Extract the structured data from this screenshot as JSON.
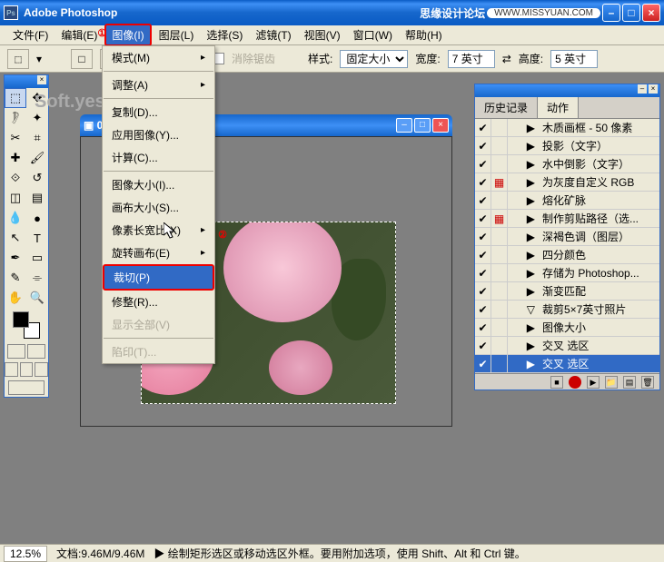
{
  "titlebar": {
    "app_name": "Adobe Photoshop",
    "forum": "思缘设计论坛",
    "url_pill": "WWW.MISSYUAN.COM"
  },
  "menubar": {
    "file": "文件(F)",
    "edit": "编辑(E)",
    "image": "图像(I)",
    "layer": "图层(L)",
    "select": "选择(S)",
    "filter": "滤镜(T)",
    "view": "视图(V)",
    "window": "窗口(W)",
    "help": "帮助(H)"
  },
  "annotations": {
    "one": "①",
    "two": "②"
  },
  "optbar": {
    "antialias": "消除锯齿",
    "style_label": "样式:",
    "style_value": "固定大小",
    "width_label": "宽度:",
    "width_value": "7 英寸",
    "height_label": "高度:",
    "height_value": "5 英寸"
  },
  "image_menu": {
    "mode": "模式(M)",
    "adjust": "调整(A)",
    "duplicate": "复制(D)...",
    "apply": "应用图像(Y)...",
    "calc": "计算(C)...",
    "img_size": "图像大小(I)...",
    "canvas_size": "画布大小(S)...",
    "pixel_ratio": "像素长宽比(X)",
    "rotate": "旋转画布(E)",
    "crop": "裁切(P)",
    "trim": "修整(R)...",
    "reveal": "显示全部(V)",
    "trap": "陷印(T)..."
  },
  "doc": {
    "title": "00... ...GB/8)"
  },
  "watermark": "Soft.yesky.c",
  "history": {
    "tab1": "历史记录",
    "tab2": "动作",
    "items": [
      {
        "check": true,
        "icon": "",
        "indent": 1,
        "arrow": "▶",
        "text": "木质画框 - 50 像素"
      },
      {
        "check": true,
        "icon": "",
        "indent": 1,
        "arrow": "▶",
        "text": "投影（文字）"
      },
      {
        "check": true,
        "icon": "",
        "indent": 1,
        "arrow": "▶",
        "text": "水中倒影（文字）"
      },
      {
        "check": true,
        "icon": "rec",
        "indent": 1,
        "arrow": "▶",
        "text": "为灰度自定义 RGB"
      },
      {
        "check": true,
        "icon": "",
        "indent": 1,
        "arrow": "▶",
        "text": "熔化矿脉"
      },
      {
        "check": true,
        "icon": "rec",
        "indent": 1,
        "arrow": "▶",
        "text": "制作剪贴路径（选..."
      },
      {
        "check": true,
        "icon": "",
        "indent": 1,
        "arrow": "▶",
        "text": "深褐色调（图层）"
      },
      {
        "check": true,
        "icon": "",
        "indent": 1,
        "arrow": "▶",
        "text": "四分颜色"
      },
      {
        "check": true,
        "icon": "",
        "indent": 1,
        "arrow": "▶",
        "text": "存储为 Photoshop..."
      },
      {
        "check": true,
        "icon": "",
        "indent": 1,
        "arrow": "▶",
        "text": "渐变匹配"
      },
      {
        "check": true,
        "icon": "",
        "indent": 1,
        "arrow": "▽",
        "text": "裁剪5×7英寸照片"
      },
      {
        "check": true,
        "icon": "",
        "indent": 2,
        "arrow": "▶",
        "text": "图像大小"
      },
      {
        "check": true,
        "icon": "",
        "indent": 2,
        "arrow": "▶",
        "text": "交叉 选区"
      },
      {
        "check": true,
        "icon": "",
        "indent": 2,
        "arrow": "▶",
        "text": "交叉 选区",
        "sel": true
      }
    ]
  },
  "statusbar": {
    "zoom": "12.5%",
    "doc_size": "文档:9.46M/9.46M",
    "tip": "▶   绘制矩形选区或移动选区外框。要用附加选项，使用 Shift、Alt 和 Ctrl 键。"
  }
}
